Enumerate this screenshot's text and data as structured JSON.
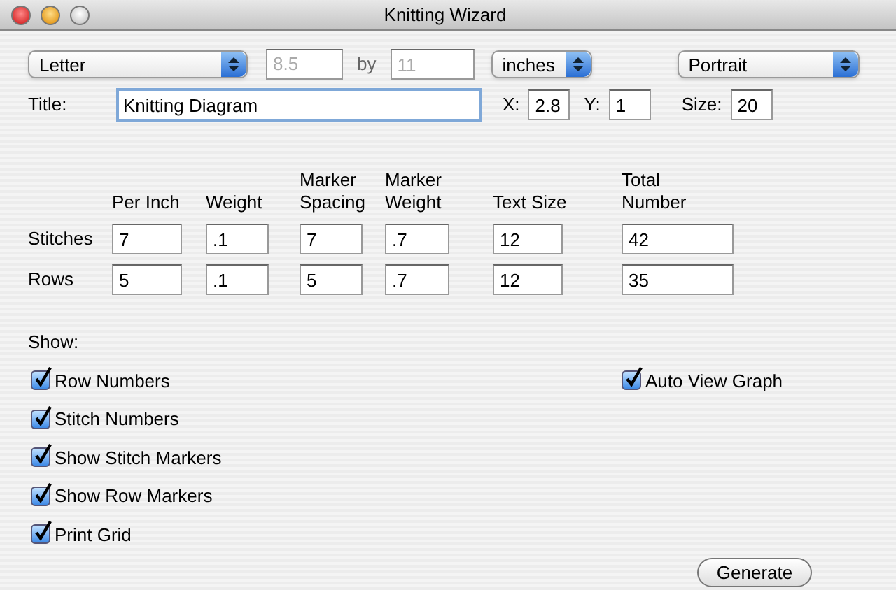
{
  "window": {
    "title": "Knitting Wizard"
  },
  "page": {
    "size": "Letter",
    "width": {
      "value": "8.5",
      "disabled": true
    },
    "by_label": "by",
    "height": {
      "value": "11",
      "disabled": true
    },
    "units": "inches",
    "orientation": "Portrait"
  },
  "title_field": {
    "label": "Title:",
    "value": "Knitting Diagram"
  },
  "position": [
    {
      "label": "X:",
      "value": "2.8"
    },
    {
      "label": "Y:",
      "value": "1"
    },
    {
      "label": "Size:",
      "value": "20"
    }
  ],
  "table": {
    "columns": [
      "Per Inch",
      "Weight",
      "Marker Spacing",
      "Marker Weight",
      "Text Size",
      "Total Number"
    ],
    "rows": [
      {
        "label": "Stitches",
        "values": [
          "7",
          ".1",
          "7",
          ".7",
          "12",
          "42"
        ]
      },
      {
        "label": "Rows",
        "values": [
          "5",
          ".1",
          "5",
          ".7",
          "12",
          "35"
        ]
      }
    ]
  },
  "show": {
    "label": "Show:",
    "options": [
      {
        "label": "Row Numbers",
        "checked": true
      },
      {
        "label": "Stitch Numbers",
        "checked": true
      },
      {
        "label": "Show Stitch Markers",
        "checked": true
      },
      {
        "label": "Show Row Markers",
        "checked": true
      },
      {
        "label": "Print Grid",
        "checked": true
      }
    ],
    "auto_view": {
      "label": "Auto View Graph",
      "checked": true
    }
  },
  "button": "Generate"
}
